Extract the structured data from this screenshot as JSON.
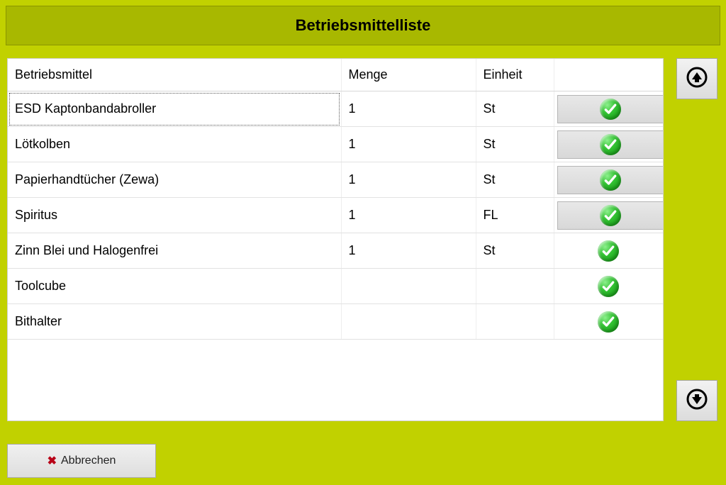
{
  "title": "Betriebsmittelliste",
  "columns": {
    "c1": "Betriebsmittel",
    "c2": "Menge",
    "c3": "Einheit",
    "c4": ""
  },
  "rows": [
    {
      "name": "ESD Kaptonbandabroller",
      "qty": "1",
      "unit": "St",
      "boxed": true,
      "focused": true
    },
    {
      "name": "Lötkolben",
      "qty": "1",
      "unit": "St",
      "boxed": true,
      "focused": false
    },
    {
      "name": "Papierhandtücher (Zewa)",
      "qty": "1",
      "unit": "St",
      "boxed": true,
      "focused": false
    },
    {
      "name": "Spiritus",
      "qty": "1",
      "unit": "FL",
      "boxed": true,
      "focused": false
    },
    {
      "name": "Zinn Blei und Halogenfrei",
      "qty": "1",
      "unit": "St",
      "boxed": false,
      "focused": false
    },
    {
      "name": "Toolcube",
      "qty": "",
      "unit": "",
      "boxed": false,
      "focused": false
    },
    {
      "name": "Bithalter",
      "qty": "",
      "unit": "",
      "boxed": false,
      "focused": false
    }
  ],
  "buttons": {
    "cancel": "Abbrechen"
  }
}
